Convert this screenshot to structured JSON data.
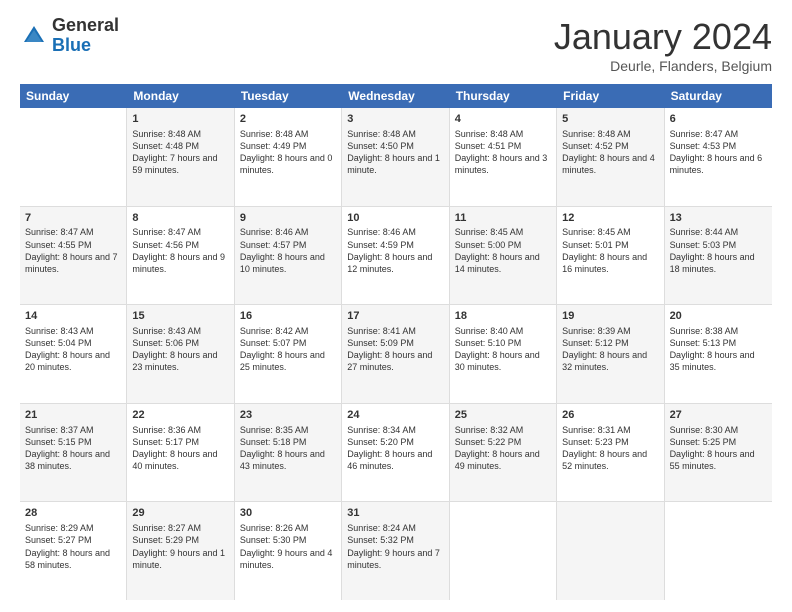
{
  "logo": {
    "general": "General",
    "blue": "Blue"
  },
  "header": {
    "month": "January 2024",
    "location": "Deurle, Flanders, Belgium"
  },
  "weekdays": [
    "Sunday",
    "Monday",
    "Tuesday",
    "Wednesday",
    "Thursday",
    "Friday",
    "Saturday"
  ],
  "rows": [
    [
      {
        "day": "",
        "sunrise": "",
        "sunset": "",
        "daylight": "",
        "shaded": false
      },
      {
        "day": "1",
        "sunrise": "Sunrise: 8:48 AM",
        "sunset": "Sunset: 4:48 PM",
        "daylight": "Daylight: 7 hours and 59 minutes.",
        "shaded": true
      },
      {
        "day": "2",
        "sunrise": "Sunrise: 8:48 AM",
        "sunset": "Sunset: 4:49 PM",
        "daylight": "Daylight: 8 hours and 0 minutes.",
        "shaded": false
      },
      {
        "day": "3",
        "sunrise": "Sunrise: 8:48 AM",
        "sunset": "Sunset: 4:50 PM",
        "daylight": "Daylight: 8 hours and 1 minute.",
        "shaded": true
      },
      {
        "day": "4",
        "sunrise": "Sunrise: 8:48 AM",
        "sunset": "Sunset: 4:51 PM",
        "daylight": "Daylight: 8 hours and 3 minutes.",
        "shaded": false
      },
      {
        "day": "5",
        "sunrise": "Sunrise: 8:48 AM",
        "sunset": "Sunset: 4:52 PM",
        "daylight": "Daylight: 8 hours and 4 minutes.",
        "shaded": true
      },
      {
        "day": "6",
        "sunrise": "Sunrise: 8:47 AM",
        "sunset": "Sunset: 4:53 PM",
        "daylight": "Daylight: 8 hours and 6 minutes.",
        "shaded": false
      }
    ],
    [
      {
        "day": "7",
        "sunrise": "Sunrise: 8:47 AM",
        "sunset": "Sunset: 4:55 PM",
        "daylight": "Daylight: 8 hours and 7 minutes.",
        "shaded": true
      },
      {
        "day": "8",
        "sunrise": "Sunrise: 8:47 AM",
        "sunset": "Sunset: 4:56 PM",
        "daylight": "Daylight: 8 hours and 9 minutes.",
        "shaded": false
      },
      {
        "day": "9",
        "sunrise": "Sunrise: 8:46 AM",
        "sunset": "Sunset: 4:57 PM",
        "daylight": "Daylight: 8 hours and 10 minutes.",
        "shaded": true
      },
      {
        "day": "10",
        "sunrise": "Sunrise: 8:46 AM",
        "sunset": "Sunset: 4:59 PM",
        "daylight": "Daylight: 8 hours and 12 minutes.",
        "shaded": false
      },
      {
        "day": "11",
        "sunrise": "Sunrise: 8:45 AM",
        "sunset": "Sunset: 5:00 PM",
        "daylight": "Daylight: 8 hours and 14 minutes.",
        "shaded": true
      },
      {
        "day": "12",
        "sunrise": "Sunrise: 8:45 AM",
        "sunset": "Sunset: 5:01 PM",
        "daylight": "Daylight: 8 hours and 16 minutes.",
        "shaded": false
      },
      {
        "day": "13",
        "sunrise": "Sunrise: 8:44 AM",
        "sunset": "Sunset: 5:03 PM",
        "daylight": "Daylight: 8 hours and 18 minutes.",
        "shaded": true
      }
    ],
    [
      {
        "day": "14",
        "sunrise": "Sunrise: 8:43 AM",
        "sunset": "Sunset: 5:04 PM",
        "daylight": "Daylight: 8 hours and 20 minutes.",
        "shaded": false
      },
      {
        "day": "15",
        "sunrise": "Sunrise: 8:43 AM",
        "sunset": "Sunset: 5:06 PM",
        "daylight": "Daylight: 8 hours and 23 minutes.",
        "shaded": true
      },
      {
        "day": "16",
        "sunrise": "Sunrise: 8:42 AM",
        "sunset": "Sunset: 5:07 PM",
        "daylight": "Daylight: 8 hours and 25 minutes.",
        "shaded": false
      },
      {
        "day": "17",
        "sunrise": "Sunrise: 8:41 AM",
        "sunset": "Sunset: 5:09 PM",
        "daylight": "Daylight: 8 hours and 27 minutes.",
        "shaded": true
      },
      {
        "day": "18",
        "sunrise": "Sunrise: 8:40 AM",
        "sunset": "Sunset: 5:10 PM",
        "daylight": "Daylight: 8 hours and 30 minutes.",
        "shaded": false
      },
      {
        "day": "19",
        "sunrise": "Sunrise: 8:39 AM",
        "sunset": "Sunset: 5:12 PM",
        "daylight": "Daylight: 8 hours and 32 minutes.",
        "shaded": true
      },
      {
        "day": "20",
        "sunrise": "Sunrise: 8:38 AM",
        "sunset": "Sunset: 5:13 PM",
        "daylight": "Daylight: 8 hours and 35 minutes.",
        "shaded": false
      }
    ],
    [
      {
        "day": "21",
        "sunrise": "Sunrise: 8:37 AM",
        "sunset": "Sunset: 5:15 PM",
        "daylight": "Daylight: 8 hours and 38 minutes.",
        "shaded": true
      },
      {
        "day": "22",
        "sunrise": "Sunrise: 8:36 AM",
        "sunset": "Sunset: 5:17 PM",
        "daylight": "Daylight: 8 hours and 40 minutes.",
        "shaded": false
      },
      {
        "day": "23",
        "sunrise": "Sunrise: 8:35 AM",
        "sunset": "Sunset: 5:18 PM",
        "daylight": "Daylight: 8 hours and 43 minutes.",
        "shaded": true
      },
      {
        "day": "24",
        "sunrise": "Sunrise: 8:34 AM",
        "sunset": "Sunset: 5:20 PM",
        "daylight": "Daylight: 8 hours and 46 minutes.",
        "shaded": false
      },
      {
        "day": "25",
        "sunrise": "Sunrise: 8:32 AM",
        "sunset": "Sunset: 5:22 PM",
        "daylight": "Daylight: 8 hours and 49 minutes.",
        "shaded": true
      },
      {
        "day": "26",
        "sunrise": "Sunrise: 8:31 AM",
        "sunset": "Sunset: 5:23 PM",
        "daylight": "Daylight: 8 hours and 52 minutes.",
        "shaded": false
      },
      {
        "day": "27",
        "sunrise": "Sunrise: 8:30 AM",
        "sunset": "Sunset: 5:25 PM",
        "daylight": "Daylight: 8 hours and 55 minutes.",
        "shaded": true
      }
    ],
    [
      {
        "day": "28",
        "sunrise": "Sunrise: 8:29 AM",
        "sunset": "Sunset: 5:27 PM",
        "daylight": "Daylight: 8 hours and 58 minutes.",
        "shaded": false
      },
      {
        "day": "29",
        "sunrise": "Sunrise: 8:27 AM",
        "sunset": "Sunset: 5:29 PM",
        "daylight": "Daylight: 9 hours and 1 minute.",
        "shaded": true
      },
      {
        "day": "30",
        "sunrise": "Sunrise: 8:26 AM",
        "sunset": "Sunset: 5:30 PM",
        "daylight": "Daylight: 9 hours and 4 minutes.",
        "shaded": false
      },
      {
        "day": "31",
        "sunrise": "Sunrise: 8:24 AM",
        "sunset": "Sunset: 5:32 PM",
        "daylight": "Daylight: 9 hours and 7 minutes.",
        "shaded": true
      },
      {
        "day": "",
        "sunrise": "",
        "sunset": "",
        "daylight": "",
        "shaded": false
      },
      {
        "day": "",
        "sunrise": "",
        "sunset": "",
        "daylight": "",
        "shaded": true
      },
      {
        "day": "",
        "sunrise": "",
        "sunset": "",
        "daylight": "",
        "shaded": false
      }
    ]
  ]
}
